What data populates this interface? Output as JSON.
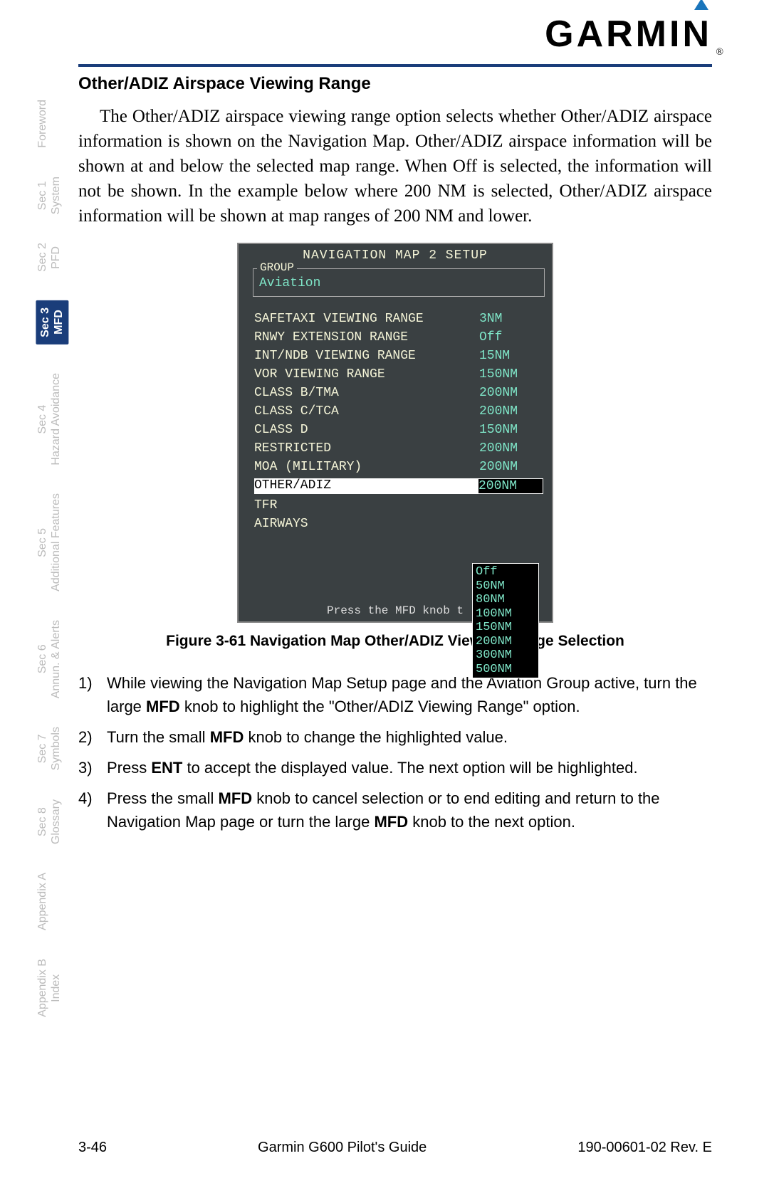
{
  "header": {
    "logo_text": "GARMIN",
    "reg_mark": "®"
  },
  "side_tabs": [
    {
      "line1": "",
      "line2": "Foreword"
    },
    {
      "line1": "Sec 1",
      "line2": "System"
    },
    {
      "line1": "Sec 2",
      "line2": "PFD"
    },
    {
      "line1": "Sec 3",
      "line2": "MFD",
      "active": true
    },
    {
      "line1": "Sec 4",
      "line2": "Hazard Avoidance"
    },
    {
      "line1": "Sec 5",
      "line2": "Additional Features"
    },
    {
      "line1": "Sec 6",
      "line2": "Annun. & Alerts"
    },
    {
      "line1": "Sec 7",
      "line2": "Symbols"
    },
    {
      "line1": "Sec 8",
      "line2": "Glossary"
    },
    {
      "line1": "",
      "line2": "Appendix A"
    },
    {
      "line1": "Appendix B",
      "line2": "Index"
    }
  ],
  "heading": "Other/ADIZ Airspace Viewing Range",
  "paragraph": "The Other/ADIZ airspace viewing range option selects whether Other/ADIZ airspace information is shown on the Navigation Map. Other/ADIZ airspace information will be shown at and below the selected map range. When Off is selected, the information will not be shown. In the example below where 200 NM is selected, Other/ADIZ airspace information will be shown at map ranges of 200 NM and lower.",
  "mfd": {
    "title": "NAVIGATION MAP 2 SETUP",
    "group_label": "GROUP",
    "group_value": "Aviation",
    "rows": [
      {
        "label": "SAFETAXI VIEWING RANGE",
        "value": "3NM"
      },
      {
        "label": "RNWY EXTENSION RANGE",
        "value": "Off"
      },
      {
        "label": "INT/NDB VIEWING RANGE",
        "value": "15NM"
      },
      {
        "label": "VOR VIEWING RANGE",
        "value": "150NM"
      },
      {
        "label": "CLASS B/TMA",
        "value": "200NM"
      },
      {
        "label": "CLASS C/TCA",
        "value": "200NM"
      },
      {
        "label": "CLASS D",
        "value": "150NM"
      },
      {
        "label": "RESTRICTED",
        "value": "200NM"
      },
      {
        "label": "MOA (MILITARY)",
        "value": "200NM"
      },
      {
        "label": "OTHER/ADIZ",
        "value": "200NM",
        "highlighted": true
      },
      {
        "label": "TFR",
        "value": ""
      },
      {
        "label": "AIRWAYS",
        "value": ""
      }
    ],
    "dropdown": [
      "Off",
      "50NM",
      "80NM",
      "100NM",
      "150NM",
      "200NM",
      "300NM",
      "500NM"
    ],
    "bottom_msg": "Press the MFD knob t"
  },
  "figure_caption": "Figure 3-61  Navigation Map Other/ADIZ Viewing Range Selection",
  "steps": [
    {
      "num": "1)",
      "text_before": "While viewing the Navigation Map Setup page and the Aviation Group active, turn the large ",
      "b1": "MFD",
      "text_mid": " knob to highlight the \"Other/ADIZ Viewing Range\" option.",
      "b2": "",
      "text_after": ""
    },
    {
      "num": "2)",
      "text_before": "Turn the small ",
      "b1": "MFD",
      "text_mid": " knob to change the highlighted value.",
      "b2": "",
      "text_after": ""
    },
    {
      "num": "3)",
      "text_before": "Press ",
      "b1": "ENT",
      "text_mid": " to accept the displayed value. The next option will be highlighted.",
      "b2": "",
      "text_after": ""
    },
    {
      "num": "4)",
      "text_before": "Press the small ",
      "b1": "MFD",
      "text_mid": " knob to cancel selection or to end editing and return to the Navigation Map page or turn the large ",
      "b2": "MFD",
      "text_after": " knob to the next option."
    }
  ],
  "footer": {
    "left": "3-46",
    "center": "Garmin G600 Pilot's Guide",
    "right": "190-00601-02  Rev. E"
  }
}
